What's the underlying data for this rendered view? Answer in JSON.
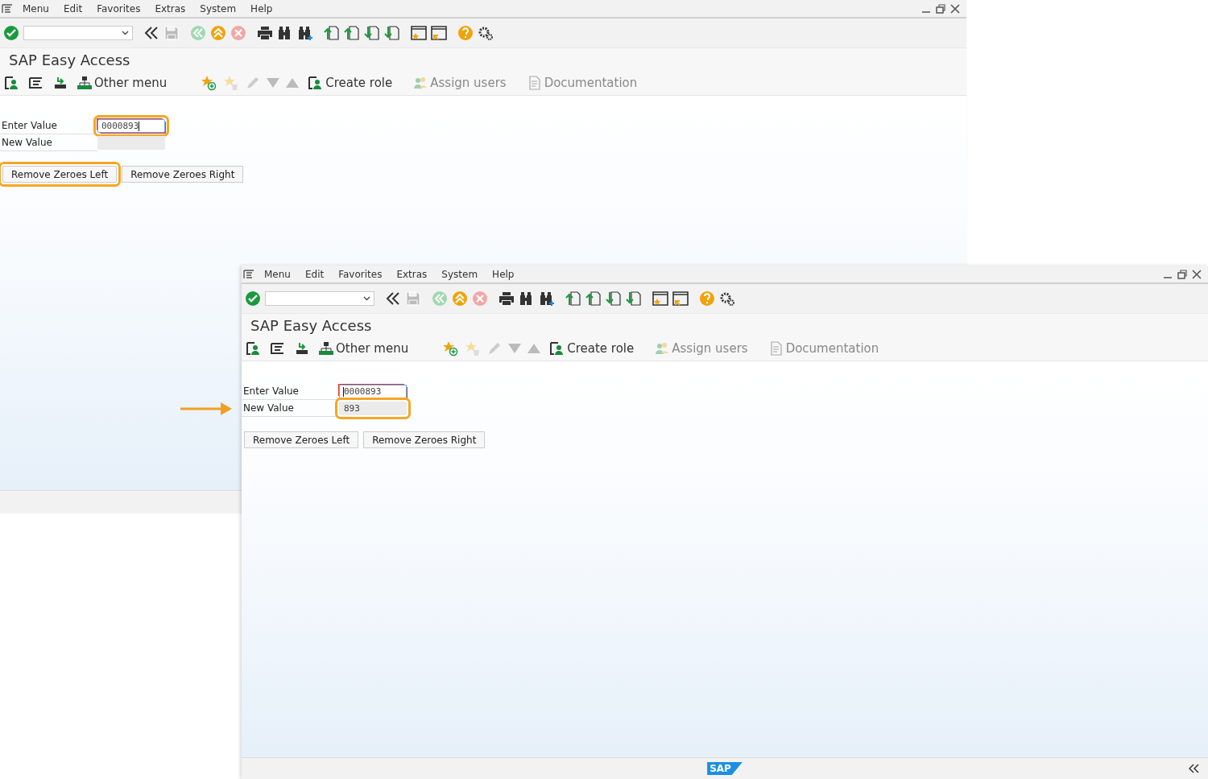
{
  "windows": [
    {
      "menu": [
        "Menu",
        "Edit",
        "Favorites",
        "Extras",
        "System",
        "Help"
      ],
      "title": "SAP Easy Access",
      "app_toolbar": [
        {
          "label": "Other menu",
          "disabled": false
        },
        {
          "label": "Create role",
          "disabled": false
        },
        {
          "label": "Assign users",
          "disabled": true
        },
        {
          "label": "Documentation",
          "disabled": true
        }
      ],
      "fields": [
        {
          "label": "Enter Value",
          "kind": "input",
          "value": "0000893",
          "highlighted": true,
          "caret_at_end": true
        },
        {
          "label": "New Value",
          "kind": "output",
          "highlighted": false
        }
      ],
      "buttons": [
        {
          "label": "Remove Zeroes Left",
          "highlighted": true
        },
        {
          "label": "Remove Zeroes Right",
          "highlighted": false
        }
      ]
    },
    {
      "menu": [
        "Menu",
        "Edit",
        "Favorites",
        "Extras",
        "System",
        "Help"
      ],
      "title": "SAP Easy Access",
      "app_toolbar": [
        {
          "label": "Other menu",
          "disabled": false
        },
        {
          "label": "Create role",
          "disabled": false
        },
        {
          "label": "Assign users",
          "disabled": true
        },
        {
          "label": "Documentation",
          "disabled": true
        }
      ],
      "fields": [
        {
          "label": "Enter Value",
          "kind": "input",
          "value": "0000893",
          "highlighted": false,
          "caret_at_end": false
        },
        {
          "label": "New Value",
          "kind": "output",
          "value": "893",
          "highlighted": true
        }
      ],
      "buttons": [
        {
          "label": "Remove Zeroes Left",
          "highlighted": false
        },
        {
          "label": "Remove Zeroes Right",
          "highlighted": false
        }
      ],
      "status_logo": "SAP"
    }
  ]
}
